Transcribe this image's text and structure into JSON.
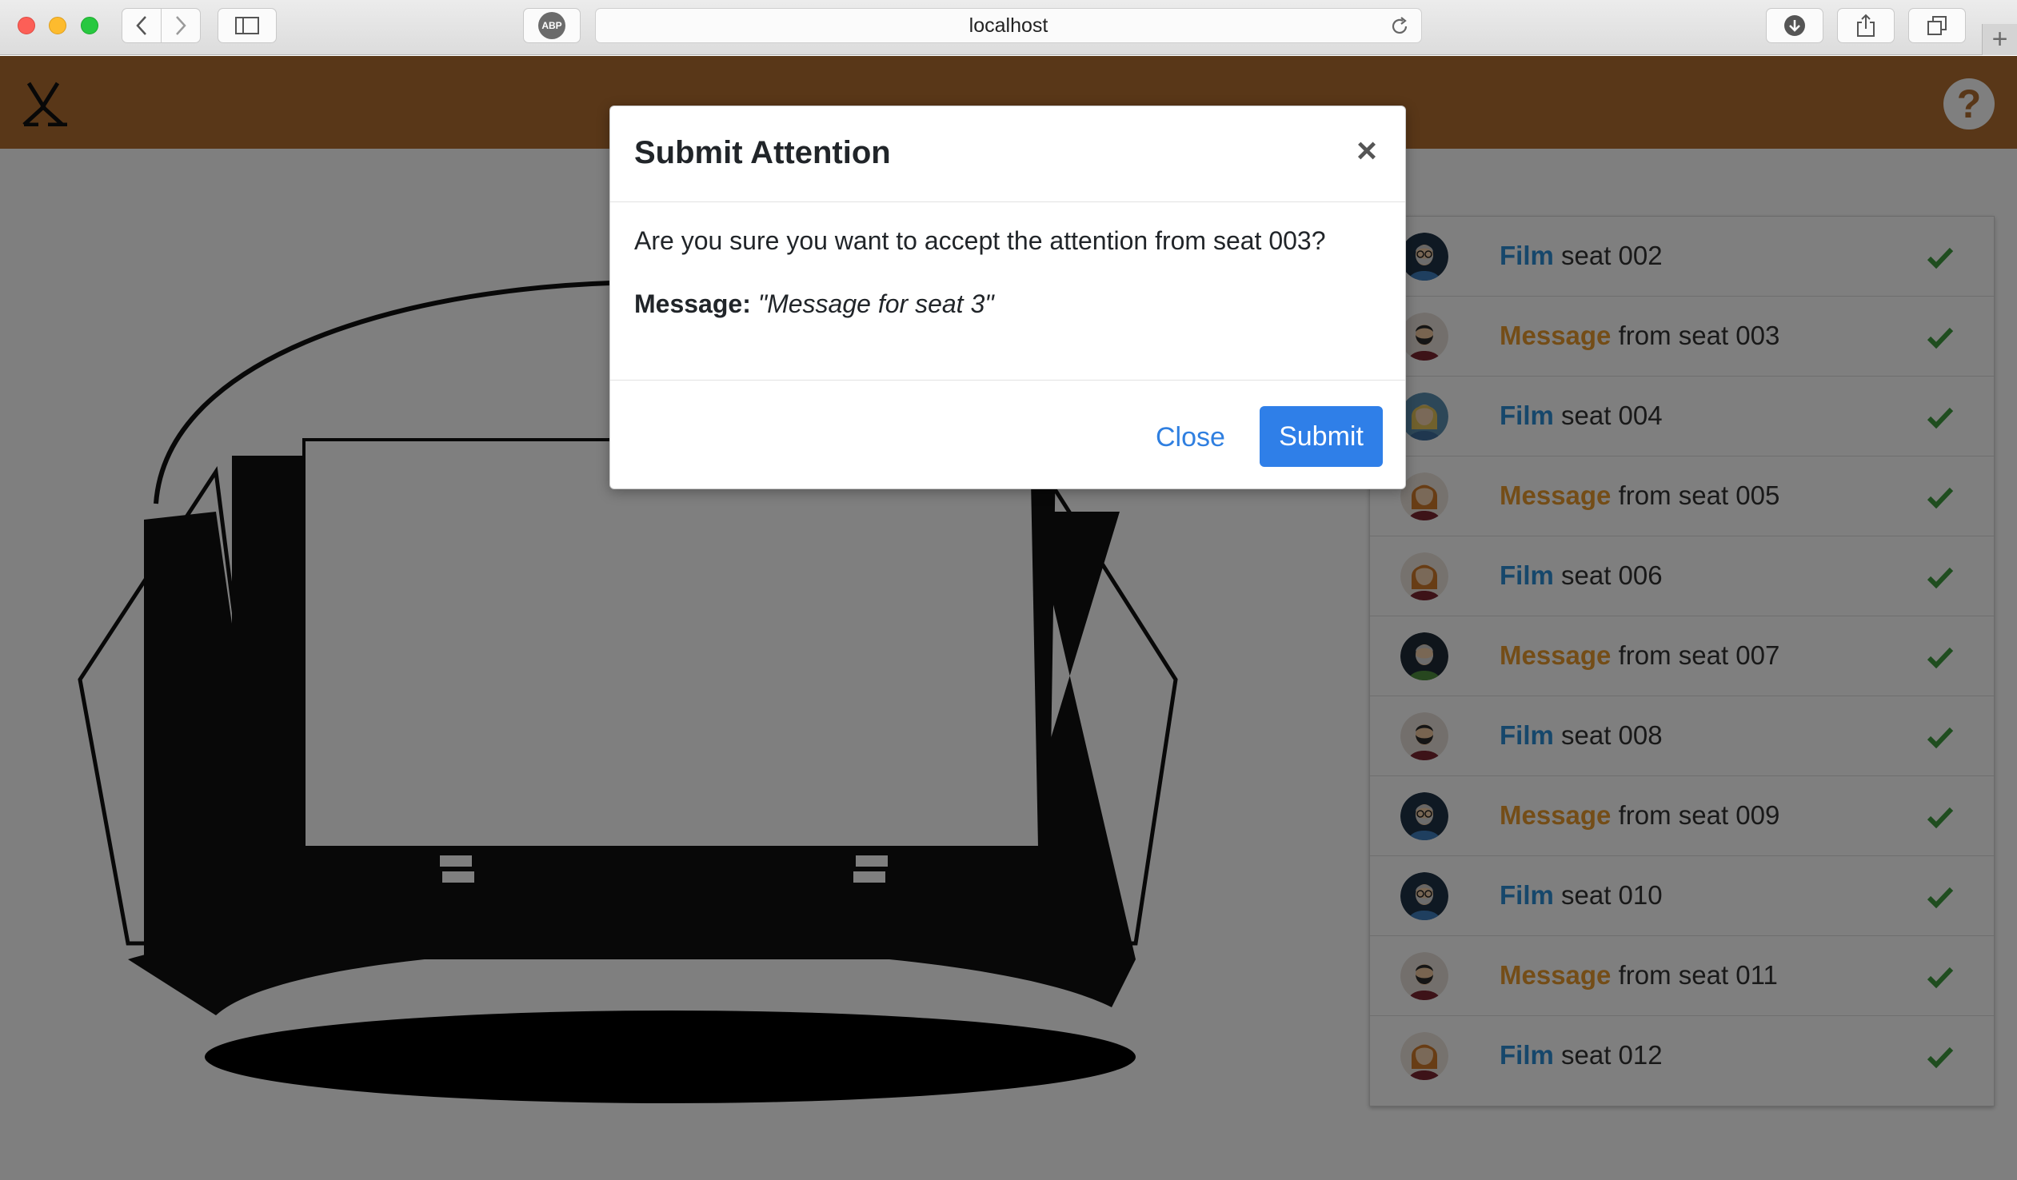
{
  "browser": {
    "url": "localhost",
    "adblock_label": "ABP"
  },
  "app": {
    "help_glyph": "?"
  },
  "attention_list": [
    {
      "kind": "Film",
      "text": " seat 002",
      "avatar": "man-grey-beard-glasses"
    },
    {
      "kind": "Message",
      "text": " from seat 003",
      "avatar": "man-dark-beard"
    },
    {
      "kind": "Film",
      "text": " seat 004",
      "avatar": "woman-blonde"
    },
    {
      "kind": "Message",
      "text": " from seat 005",
      "avatar": "woman-brown-hair"
    },
    {
      "kind": "Film",
      "text": " seat 006",
      "avatar": "woman-brown-hair"
    },
    {
      "kind": "Message",
      "text": " from seat 007",
      "avatar": "man-grey-beard"
    },
    {
      "kind": "Film",
      "text": " seat 008",
      "avatar": "man-dark-beard"
    },
    {
      "kind": "Message",
      "text": " from seat 009",
      "avatar": "man-grey-beard-glasses"
    },
    {
      "kind": "Film",
      "text": " seat 010",
      "avatar": "man-grey-beard-glasses"
    },
    {
      "kind": "Message",
      "text": " from seat 011",
      "avatar": "man-dark-beard"
    },
    {
      "kind": "Film",
      "text": " seat 012",
      "avatar": "woman-brown-hair"
    }
  ],
  "modal": {
    "title": "Submit Attention",
    "close_glyph": "×",
    "question": "Are you sure you want to accept the attention from seat 003?",
    "message_label": "Message:",
    "message_value": "\"Message for seat 3\"",
    "close_button": "Close",
    "submit_button": "Submit"
  },
  "colors": {
    "topbar": "#b36f30",
    "film_keyword": "#2d8fd6",
    "message_keyword": "#e89b2f",
    "check": "#3f9a3f",
    "submit_button": "#2f7fe8"
  }
}
